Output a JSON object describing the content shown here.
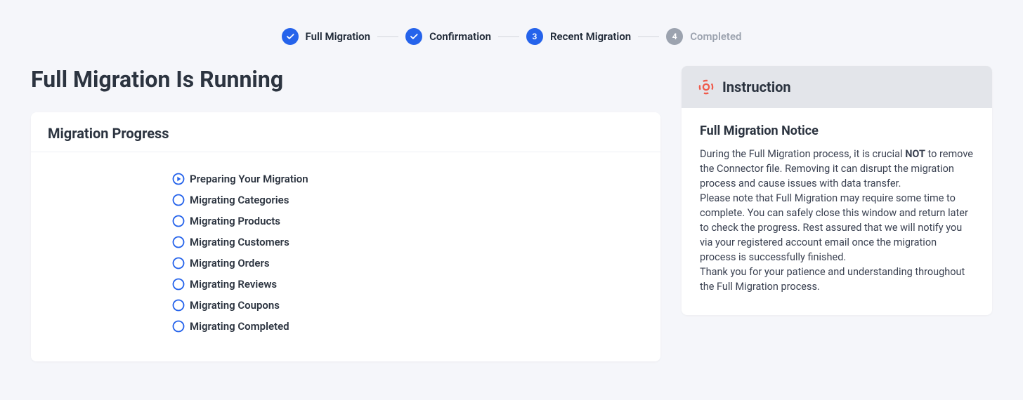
{
  "steps": [
    {
      "label": "Full Migration",
      "state": "completed"
    },
    {
      "label": "Confirmation",
      "state": "completed"
    },
    {
      "label": "Recent Migration",
      "state": "current",
      "number": "3"
    },
    {
      "label": "Completed",
      "state": "pending",
      "number": "4"
    }
  ],
  "page_title": "Full Migration Is Running",
  "progress_card_title": "Migration Progress",
  "progress_items": [
    {
      "label": "Preparing Your Migration",
      "state": "running"
    },
    {
      "label": "Migrating Categories",
      "state": "pending"
    },
    {
      "label": "Migrating Products",
      "state": "pending"
    },
    {
      "label": "Migrating Customers",
      "state": "pending"
    },
    {
      "label": "Migrating Orders",
      "state": "pending"
    },
    {
      "label": "Migrating Reviews",
      "state": "pending"
    },
    {
      "label": "Migrating Coupons",
      "state": "pending"
    },
    {
      "label": "Migrating Completed",
      "state": "pending"
    }
  ],
  "instruction": {
    "header": "Instruction",
    "subtitle": "Full Migration Notice",
    "p1_before": "During the Full Migration process, it is crucial ",
    "p1_strong": "NOT",
    "p1_after": " to remove the Connector file. Removing it can disrupt the migration process and cause issues with data transfer.",
    "p2": "Please note that Full Migration may require some time to complete. You can safely close this window and return later to check the progress. Rest assured that we will notify you via your registered account email once the migration process is successfully finished.",
    "p3": "Thank you for your patience and understanding throughout the Full Migration process."
  },
  "colors": {
    "primary": "#2563eb",
    "muted": "#9ca3af",
    "lifebuoy": "#ef5b4c"
  }
}
